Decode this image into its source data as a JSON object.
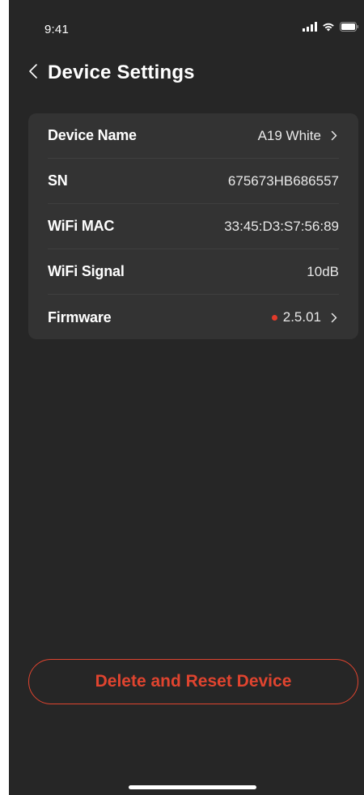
{
  "status_bar": {
    "time": "9:41",
    "icons": [
      "cellular-signal-icon",
      "wifi-icon",
      "battery-icon"
    ]
  },
  "header": {
    "back_icon": "chevron-left-icon",
    "title": "Device Settings"
  },
  "settings": {
    "device_name": {
      "label": "Device Name",
      "value": "A19 White"
    },
    "sn": {
      "label": "SN",
      "value": "675673HB686557"
    },
    "wifi_mac": {
      "label": "WiFi MAC",
      "value": "33:45:D3:S7:56:89"
    },
    "wifi_signal": {
      "label": "WiFi Signal",
      "value": "10dB"
    },
    "firmware": {
      "label": "Firmware",
      "value": "2.5.01",
      "update_indicator_color": "#e23a2a"
    }
  },
  "actions": {
    "delete_label": "Delete and Reset Device"
  },
  "colors": {
    "background": "#262626",
    "card": "#333333",
    "accent": "#e0442f",
    "text": "#ffffff"
  }
}
